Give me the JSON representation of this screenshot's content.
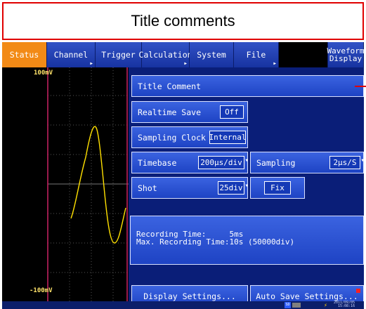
{
  "banner": {
    "title": "Title comments"
  },
  "tabs": [
    {
      "label": "Status",
      "active": true
    },
    {
      "label": "Channel"
    },
    {
      "label": "Trigger"
    },
    {
      "label": "Calculation"
    },
    {
      "label": "System"
    },
    {
      "label": "File"
    },
    {
      "label": ""
    },
    {
      "label_line1": "Waveform",
      "label_line2": "Display"
    }
  ],
  "scope": {
    "top_label": "100mV",
    "bottom_label": "-100mV"
  },
  "settings": {
    "title_comment": "Title Comment",
    "realtime_save": {
      "label": "Realtime Save",
      "value": "Off"
    },
    "sampling_clock": {
      "label": "Sampling Clock",
      "value": "Internal"
    },
    "timebase": {
      "label": "Timebase",
      "value": "200µs/div"
    },
    "sampling": {
      "label": "Sampling",
      "value": "2µs/S"
    },
    "shot": {
      "label": "Shot",
      "value": "25div",
      "fix_label": "Fix"
    },
    "recording_time_line": "Recording Time:     5ms",
    "max_recording_line": "Max. Recording Time:10s (50000div)",
    "display_settings_label": "Display Settings...",
    "auto_save_label": "Auto Save Settings..."
  },
  "statusbar": {
    "sd_label": "SD",
    "date": "2011/09/05",
    "time": "15:08:16"
  },
  "colors": {
    "accent_tab": "#f28a16",
    "banner_border": "#e00000",
    "waveform": "#ffe000",
    "background": "#0a1e78"
  },
  "icons": [
    "sd-card-icon",
    "battery-icon",
    "ac-power-icon"
  ]
}
